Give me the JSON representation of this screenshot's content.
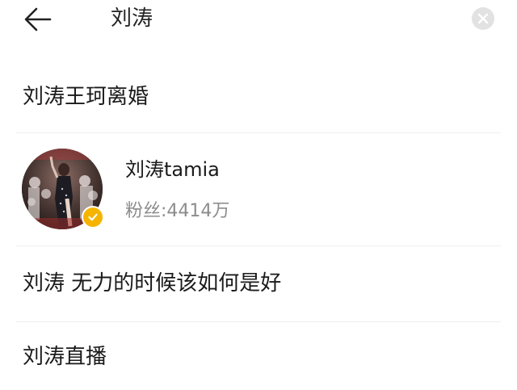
{
  "header": {
    "query": "刘涛",
    "back_icon": "arrow-left-icon",
    "clear_icon": "close-icon"
  },
  "suggestions": [
    {
      "text": "刘涛王珂离婚"
    },
    {
      "text": "刘涛 无力的时候该如何是好"
    },
    {
      "text": "刘涛直播"
    }
  ],
  "user_card": {
    "name": "刘涛tamia",
    "followers": "粉丝:4414万",
    "verified_badge_color": "#f5b400",
    "verified_icon": "check-icon"
  }
}
